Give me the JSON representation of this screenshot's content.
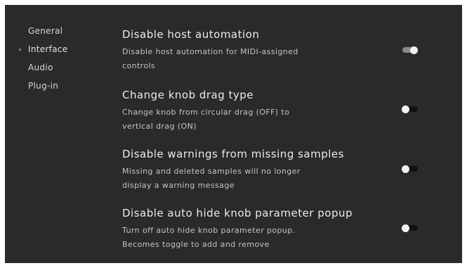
{
  "sidebar": {
    "items": [
      {
        "label": "General",
        "active": false
      },
      {
        "label": "Interface",
        "active": true
      },
      {
        "label": "Audio",
        "active": false
      },
      {
        "label": "Plug-in",
        "active": false
      }
    ]
  },
  "settings": [
    {
      "title": "Disable host automation",
      "desc_line1": "Disable host automation for MIDI-assigned",
      "desc_line2": "controls",
      "enabled": true
    },
    {
      "title": "Change knob drag type",
      "desc_line1": "Change knob from circular drag (OFF) to",
      "desc_line2": "vertical drag (ON)",
      "enabled": false
    },
    {
      "title": "Disable warnings from missing samples",
      "desc_line1": "Missing and deleted samples will no longer",
      "desc_line2": "display a warning message",
      "enabled": false
    },
    {
      "title": "Disable auto hide knob parameter popup",
      "desc_line1": "Turn off auto hide knob parameter popup.",
      "desc_line2": "Becomes toggle to add and remove",
      "enabled": false
    }
  ],
  "colors": {
    "panel_bg": "#2a2a2a",
    "toggle_on": "#8a8a8a",
    "toggle_off": "#111111",
    "knob": "#f2f2f2"
  }
}
